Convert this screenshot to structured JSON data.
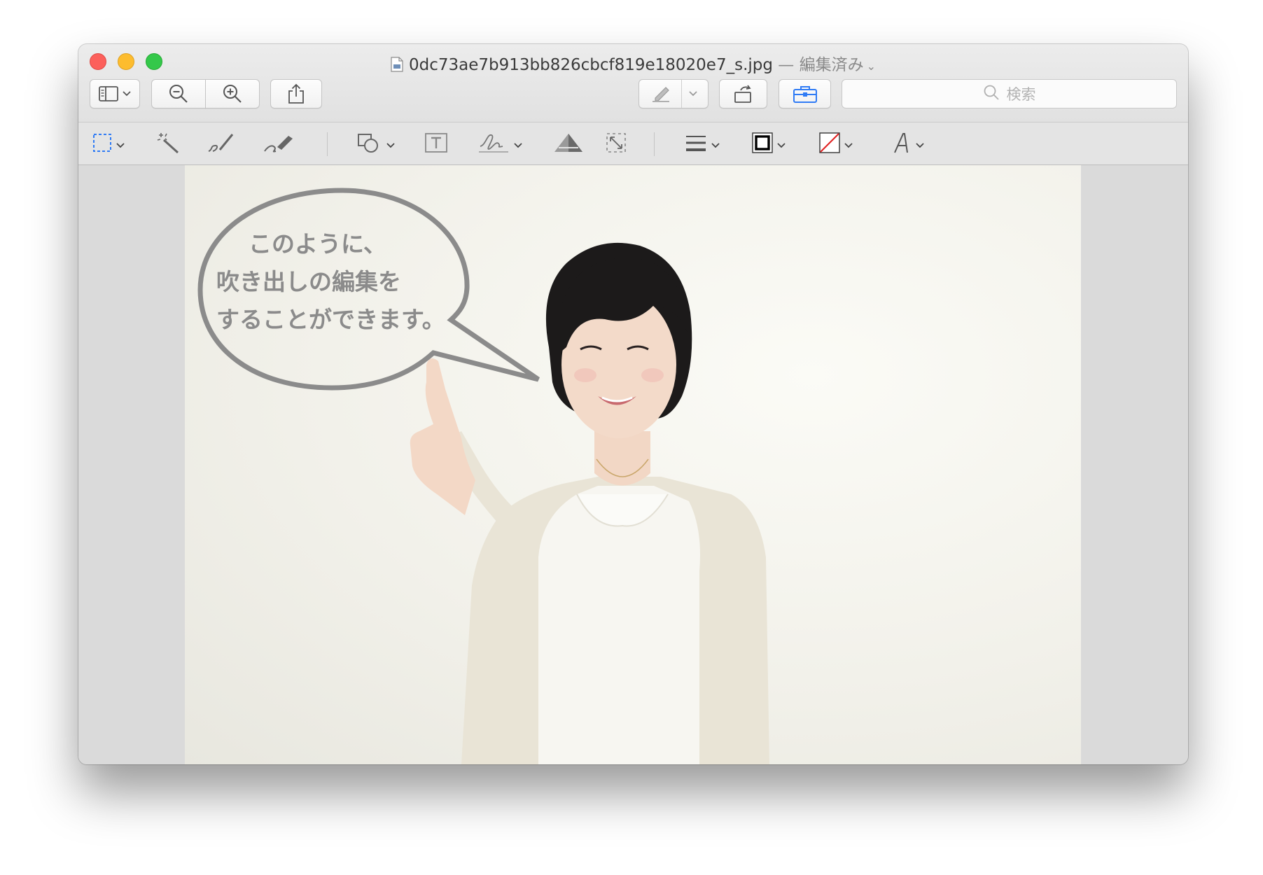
{
  "window": {
    "filename": "0dc73ae7b913bb826cbcf819e18020e7_s.jpg",
    "separator": "—",
    "status": "編集済み"
  },
  "toolbar": {
    "search_placeholder": "検索"
  },
  "image": {
    "speech_bubble": {
      "lines": [
        "このように、",
        "吹き出しの編集を",
        "することができます。"
      ]
    }
  },
  "colors": {
    "close": "#fc605b",
    "minimize": "#fdbc2e",
    "zoom": "#34c84a",
    "selection_accent": "#2f7bf5",
    "toolbox_accent": "#2f7bf5",
    "bubble_stroke": "#8b8b8b"
  },
  "icons": {
    "toolbar": [
      "sidebar-icon",
      "zoom-out-icon",
      "zoom-in-icon",
      "share-icon",
      "highlight-pen-icon",
      "rotate-icon",
      "toolbox-icon",
      "search-icon"
    ],
    "markup": [
      "rectangular-selection-icon",
      "instant-alpha-icon",
      "sketch-icon",
      "draw-icon",
      "shapes-icon",
      "text-icon",
      "signature-icon",
      "adjust-color-icon",
      "adjust-size-icon",
      "shape-style-icon",
      "border-color-icon",
      "fill-color-icon",
      "text-style-icon"
    ]
  }
}
